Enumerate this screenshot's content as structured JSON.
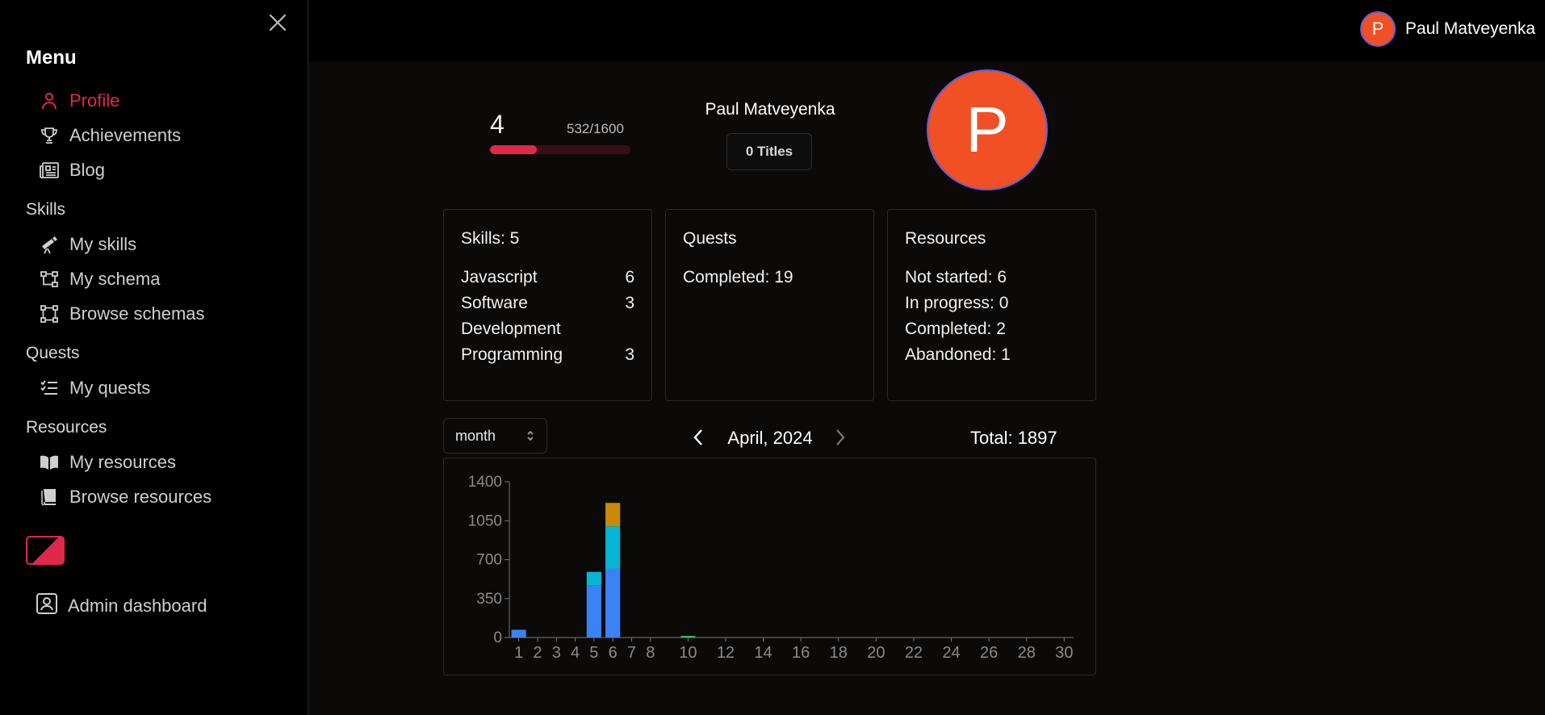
{
  "sidebar": {
    "menu_title": "Menu",
    "items_main": [
      {
        "label": "Profile",
        "icon": "user-icon",
        "active": true
      },
      {
        "label": "Achievements",
        "icon": "trophy-icon"
      },
      {
        "label": "Blog",
        "icon": "newspaper-icon"
      }
    ],
    "skills_title": "Skills",
    "items_skills": [
      {
        "label": "My skills",
        "icon": "telescope-icon"
      },
      {
        "label": "My schema",
        "icon": "schema-icon"
      },
      {
        "label": "Browse schemas",
        "icon": "vector-square-icon"
      }
    ],
    "quests_title": "Quests",
    "items_quests": [
      {
        "label": "My quests",
        "icon": "checklist-icon"
      }
    ],
    "resources_title": "Resources",
    "items_resources": [
      {
        "label": "My resources",
        "icon": "open-book-icon"
      },
      {
        "label": "Browse resources",
        "icon": "book-icon"
      }
    ],
    "admin_label": "Admin dashboard"
  },
  "topbar": {
    "user_initial": "P",
    "user_name": "Paul Matveyenka"
  },
  "profile": {
    "level": "4",
    "xp_text": "532/1600",
    "xp_progress": 0.3325,
    "name": "Paul Matveyenka",
    "titles_label": "0 Titles",
    "avatar_initial": "P"
  },
  "cards": {
    "skills": {
      "title": "Skills: 5",
      "rows": [
        {
          "label": "Javascript",
          "value": "6"
        },
        {
          "label": "Software Development",
          "value": "3"
        },
        {
          "label": "Programming",
          "value": "3"
        }
      ]
    },
    "quests": {
      "title": "Quests",
      "lines": [
        "Completed: 19"
      ]
    },
    "resources": {
      "title": "Resources",
      "lines": [
        "Not started: 6",
        "In progress: 0",
        "Completed: 2",
        "Abandoned: 1"
      ]
    }
  },
  "controls": {
    "period": "month",
    "month_label": "April, 2024",
    "total": "Total: 1897"
  },
  "colors": {
    "accent": "#e0284a",
    "avatar": "#f05023",
    "series_blue": "#3b82f6",
    "series_cyan": "#06b6d4",
    "series_gold": "#ca8a04",
    "series_green": "#22c55e"
  },
  "chart_data": {
    "type": "bar",
    "stacked": true,
    "x": [
      1,
      2,
      3,
      4,
      5,
      6,
      7,
      8,
      9,
      10,
      11,
      12,
      13,
      14,
      15,
      16,
      17,
      18,
      19,
      20,
      21,
      22,
      23,
      24,
      25,
      26,
      27,
      28,
      29,
      30
    ],
    "x_tick_labels": [
      "1",
      "2",
      "3",
      "4",
      "5",
      "6",
      "7",
      "8",
      "10",
      "12",
      "14",
      "16",
      "18",
      "20",
      "22",
      "24",
      "26",
      "28",
      "30"
    ],
    "ylim": [
      0,
      1400
    ],
    "y_ticks": [
      0,
      350,
      700,
      1050,
      1400
    ],
    "series": [
      {
        "color": "#3b82f6",
        "values": [
          70,
          0,
          0,
          0,
          470,
          620,
          0,
          0,
          0,
          0,
          0,
          0,
          0,
          0,
          0,
          0,
          0,
          0,
          0,
          0,
          0,
          0,
          0,
          0,
          0,
          0,
          0,
          0,
          0,
          0
        ]
      },
      {
        "color": "#06b6d4",
        "values": [
          0,
          0,
          0,
          0,
          120,
          380,
          0,
          0,
          0,
          0,
          0,
          0,
          0,
          0,
          0,
          0,
          0,
          0,
          0,
          0,
          0,
          0,
          0,
          0,
          0,
          0,
          0,
          0,
          0,
          0
        ]
      },
      {
        "color": "#ca8a04",
        "values": [
          0,
          0,
          0,
          0,
          0,
          210,
          0,
          0,
          0,
          0,
          0,
          0,
          0,
          0,
          0,
          0,
          0,
          0,
          0,
          0,
          0,
          0,
          0,
          0,
          0,
          0,
          0,
          0,
          0,
          0
        ]
      },
      {
        "color": "#22c55e",
        "values": [
          0,
          0,
          0,
          0,
          0,
          0,
          0,
          0,
          0,
          15,
          0,
          0,
          0,
          0,
          0,
          0,
          0,
          0,
          0,
          0,
          0,
          0,
          0,
          0,
          0,
          0,
          0,
          0,
          0,
          0
        ]
      }
    ]
  }
}
